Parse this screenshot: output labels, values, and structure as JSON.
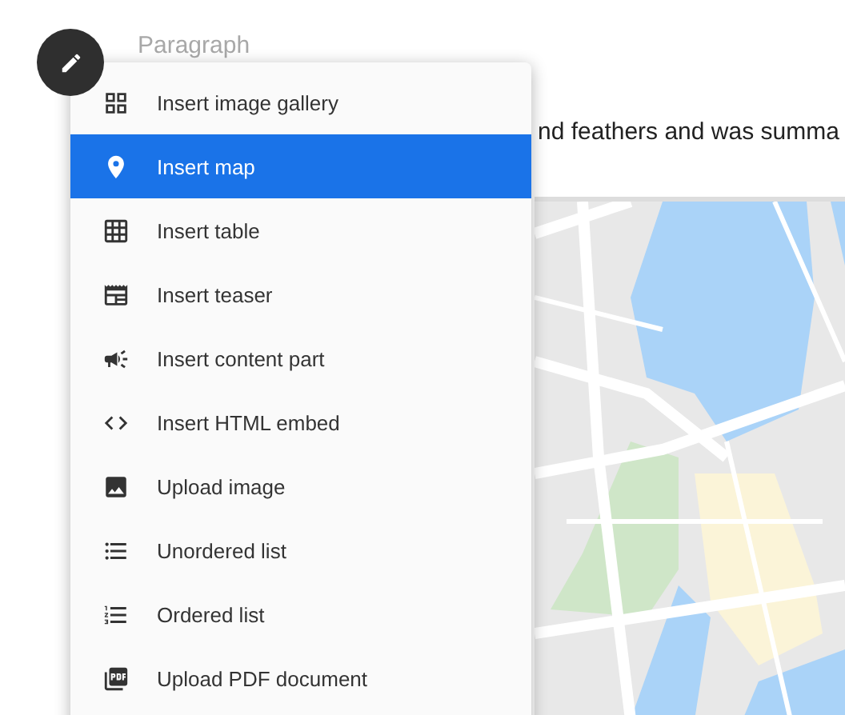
{
  "editor": {
    "placeholder": "Paragraph",
    "paragraph_visible": "nd feathers and was summa"
  },
  "insert_menu": {
    "items": [
      {
        "label": "Insert image gallery",
        "selected": false
      },
      {
        "label": "Insert map",
        "selected": true
      },
      {
        "label": "Insert table",
        "selected": false
      },
      {
        "label": "Insert teaser",
        "selected": false
      },
      {
        "label": "Insert content part",
        "selected": false
      },
      {
        "label": "Insert HTML embed",
        "selected": false
      },
      {
        "label": "Upload image",
        "selected": false
      },
      {
        "label": "Unordered list",
        "selected": false
      },
      {
        "label": "Ordered list",
        "selected": false
      },
      {
        "label": "Upload PDF document",
        "selected": false
      }
    ]
  }
}
